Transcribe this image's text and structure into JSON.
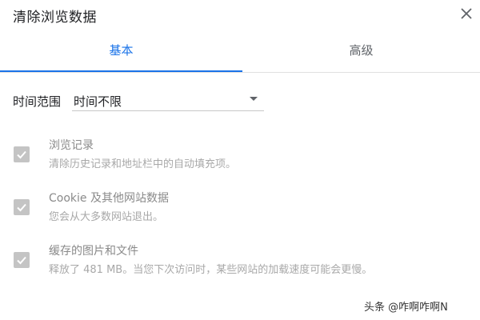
{
  "dialog": {
    "title": "清除浏览数据",
    "close_icon": "close-icon"
  },
  "tabs": [
    {
      "label": "基本",
      "selected": true
    },
    {
      "label": "高级",
      "selected": false
    }
  ],
  "time_range": {
    "label": "时间范围",
    "selected": "时间不限"
  },
  "options": [
    {
      "title": "浏览记录",
      "description": "清除历史记录和地址栏中的自动填充项。",
      "checked": true
    },
    {
      "title": "Cookie 及其他网站数据",
      "description": "您会从大多数网站退出。",
      "checked": true
    },
    {
      "title": "缓存的图片和文件",
      "description": "释放了 481 MB。当您下次访问时，某些网站的加载速度可能会更慢。",
      "checked": true
    }
  ],
  "watermark": "头条 @咋啊咋啊N",
  "colors": {
    "accent": "#1a73e8",
    "checkbox_disabled": "#c4c4c4"
  }
}
